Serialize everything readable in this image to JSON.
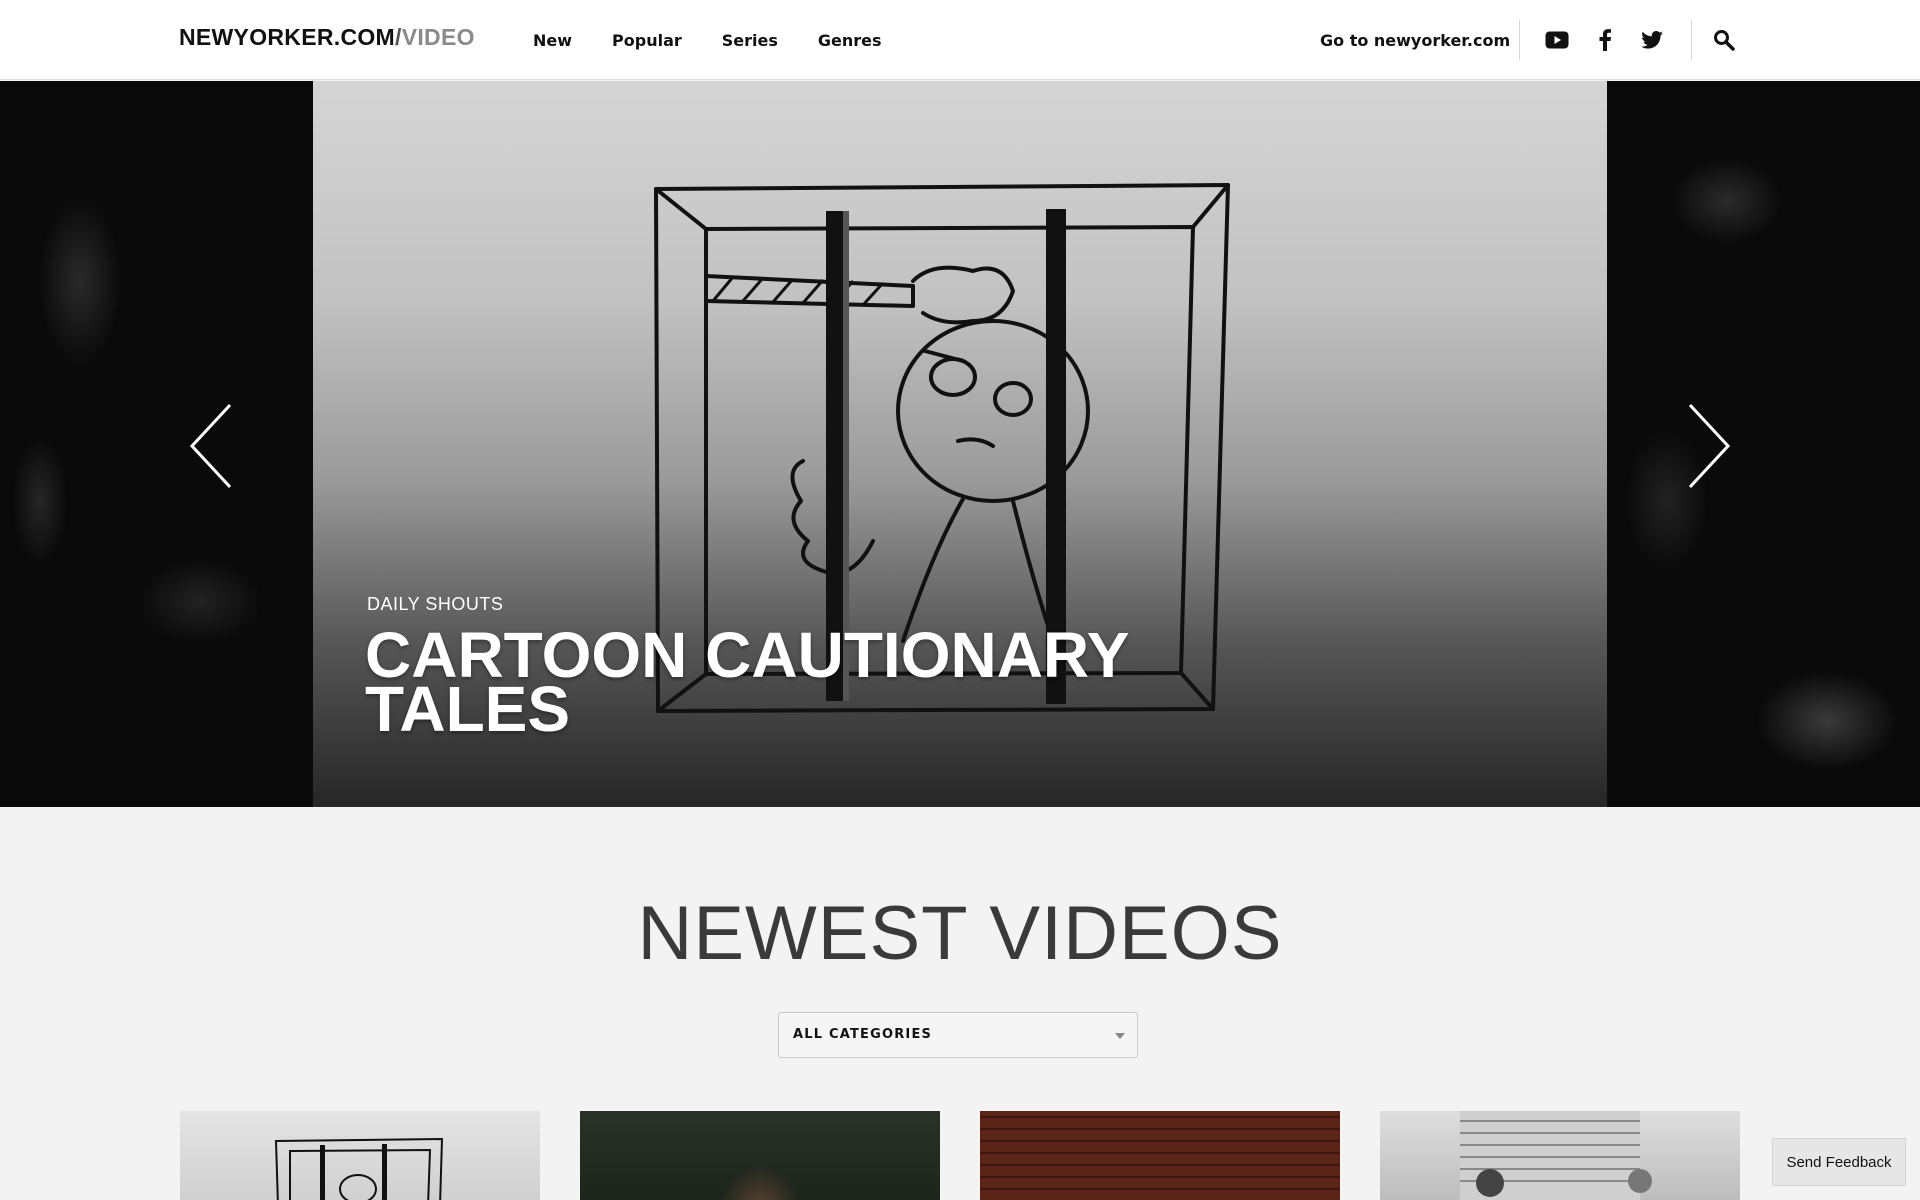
{
  "header": {
    "logo": {
      "main": "NEWYORKER.COM",
      "slash": "/",
      "suffix": "VIDEO"
    },
    "nav": [
      "New",
      "Popular",
      "Series",
      "Genres"
    ],
    "external_link": "Go to newyorker.com",
    "social_icons": [
      "youtube-icon",
      "facebook-icon",
      "twitter-icon"
    ],
    "search_icon": "search-icon"
  },
  "hero": {
    "kicker": "DAILY SHOUTS",
    "title": "CARTOON CAUTIONARY TALES",
    "prev_icon": "chevron-left-icon",
    "next_icon": "chevron-right-icon"
  },
  "newest": {
    "title": "NEWEST VIDEOS",
    "category_select": "ALL CATEGORIES"
  },
  "feedback_label": "Send Feedback",
  "colors": {
    "background": "#f3f3f3",
    "header_bg": "#ffffff",
    "title_text": "#3a3a3a",
    "accent_dark": "#111111"
  }
}
